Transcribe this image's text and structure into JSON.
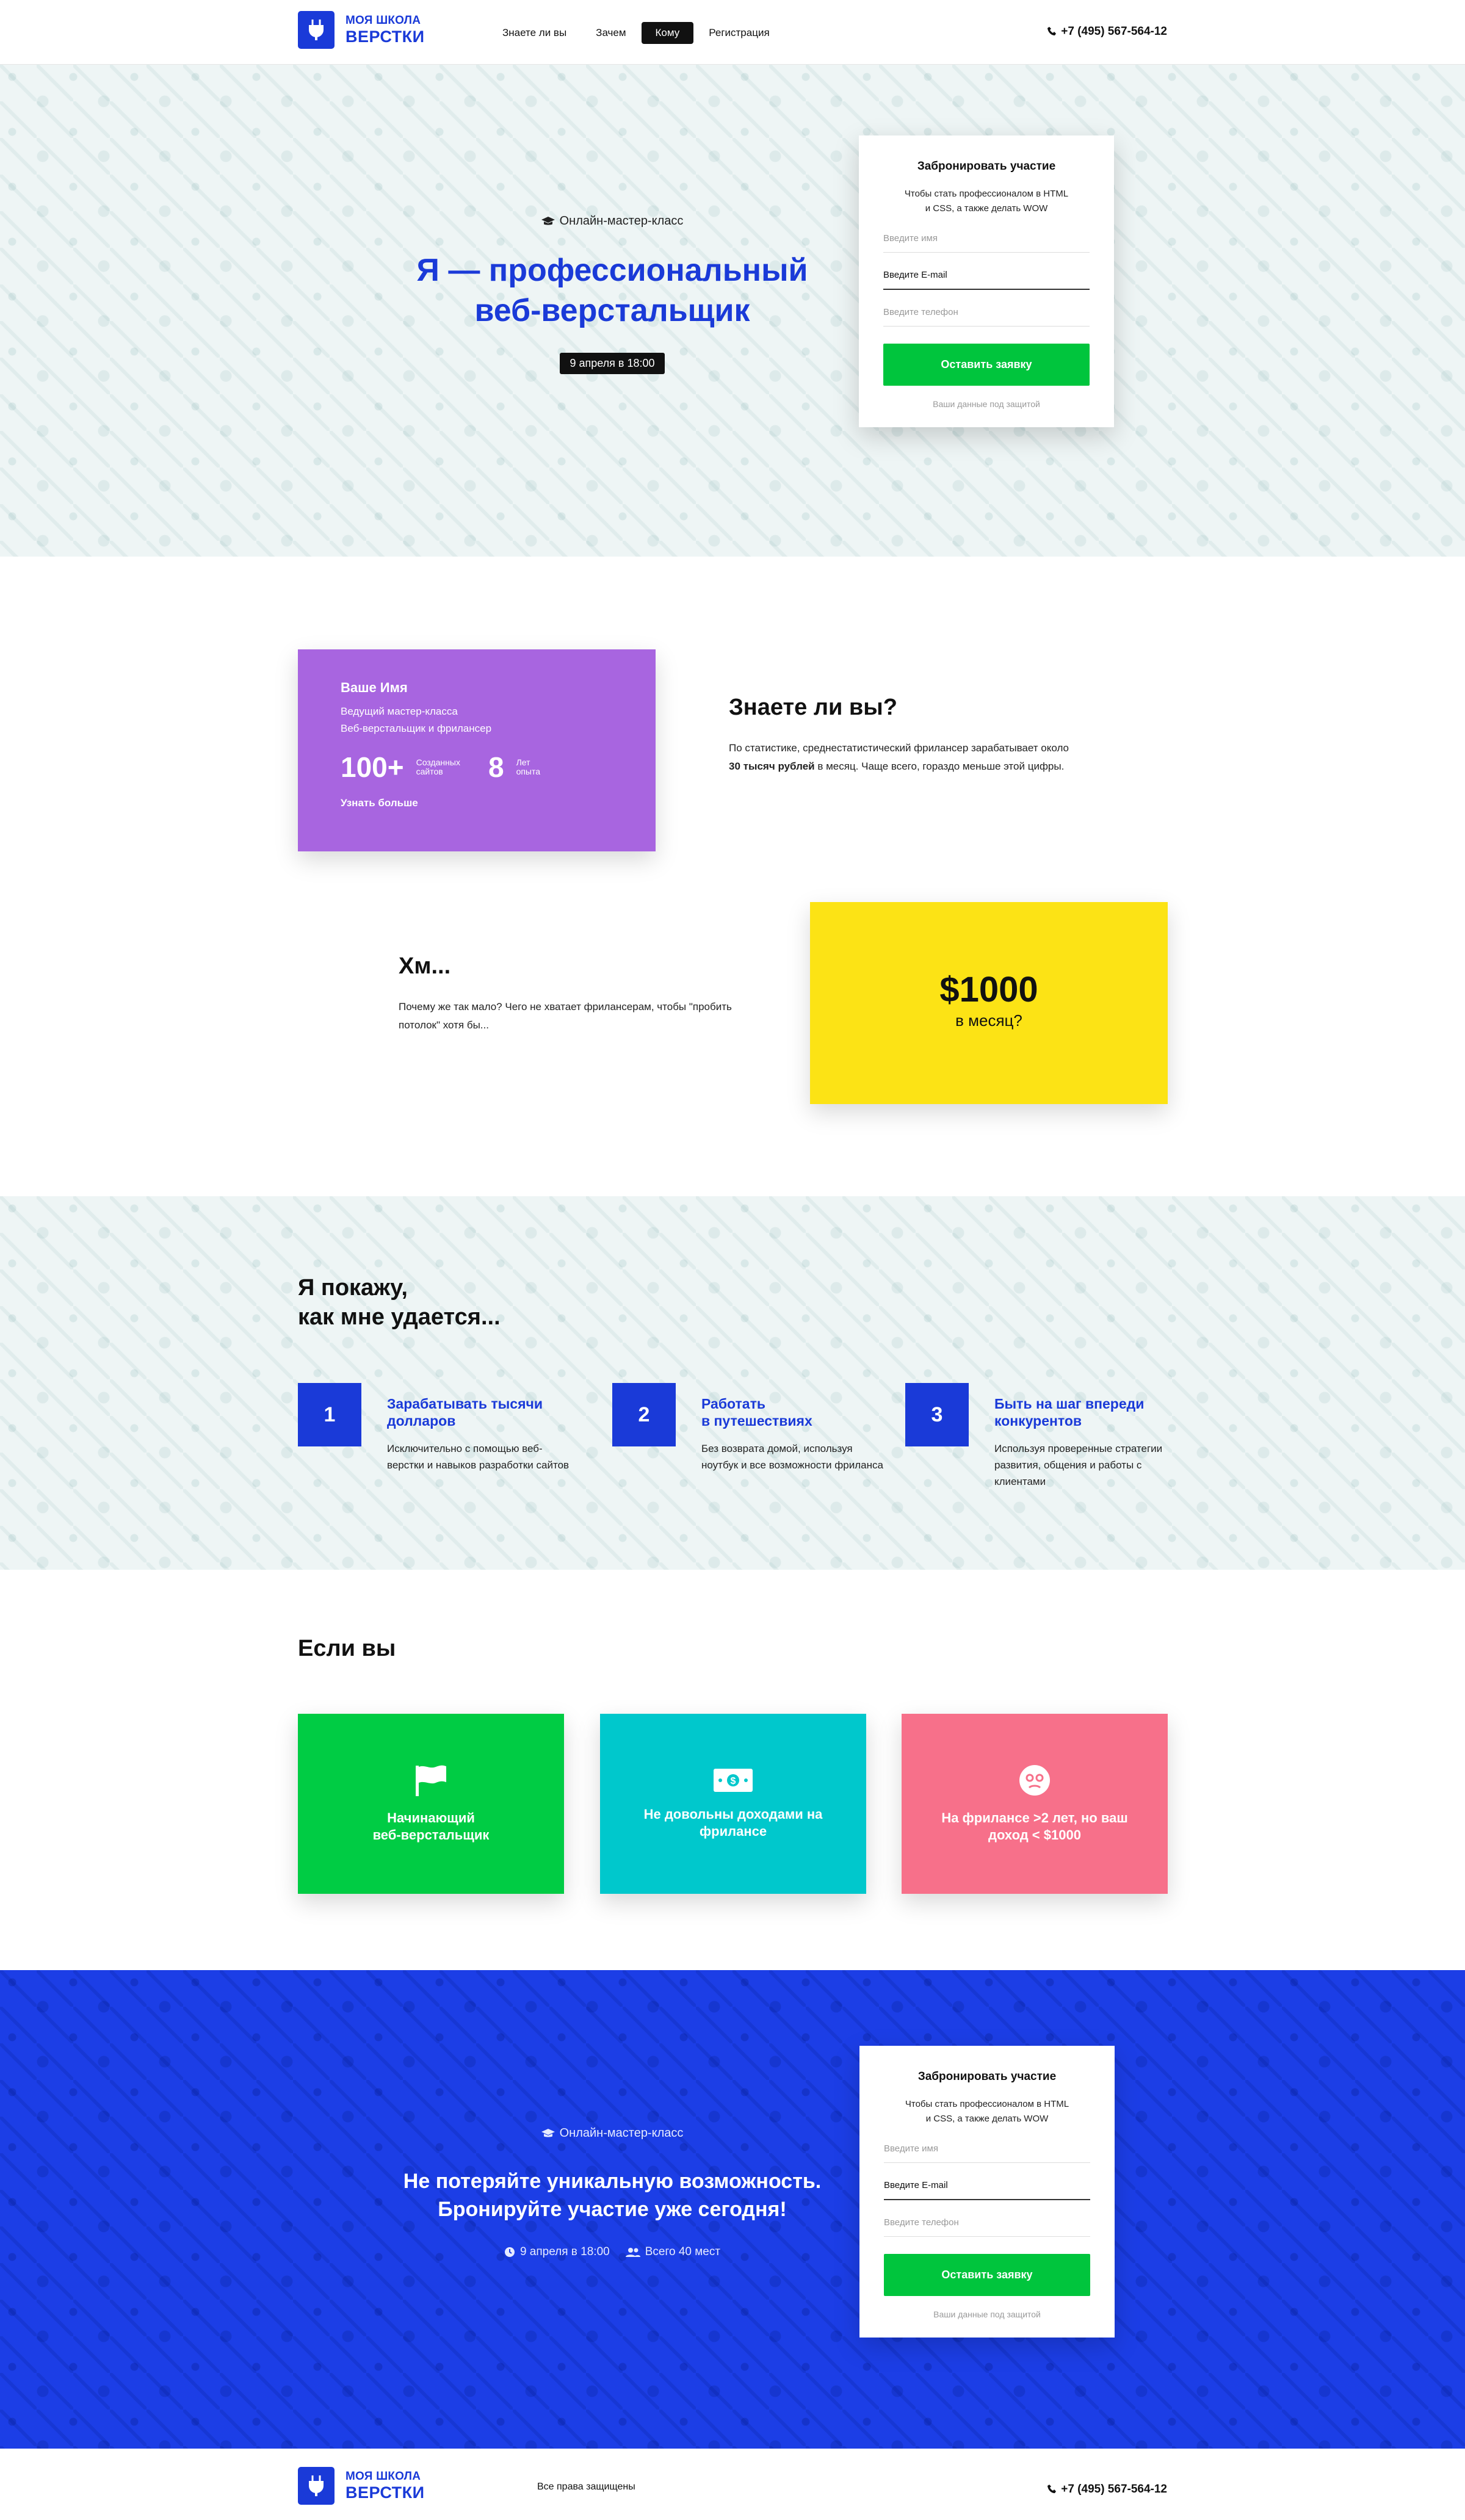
{
  "brand": {
    "line1": "МОЯ ШКОЛА",
    "line2": "ВЕРСТКИ"
  },
  "nav": [
    {
      "label": "Знаете ли вы",
      "active": false
    },
    {
      "label": "Зачем",
      "active": false
    },
    {
      "label": "Кому",
      "active": true
    },
    {
      "label": "Регистрация",
      "active": false
    }
  ],
  "phone": "+7 (495) 567-564-12",
  "hero": {
    "subtitle": "Онлайн-мастер-класс",
    "title_line1": "Я — профессиональный",
    "title_line2": "веб-верстальщик",
    "date": "9 апреля в 18:00"
  },
  "form": {
    "title": "Забронировать участие",
    "desc_line1": "Чтобы стать профессионалом в  HTML",
    "desc_line2": "и CSS, а также делать WOW",
    "name_placeholder": "Введите имя",
    "email_value": "Введите E-mail",
    "phone_placeholder": "Введите телефон",
    "submit": "Оставить заявку",
    "secure": "Ваши данные под защитой"
  },
  "author": {
    "name": "Ваше Имя",
    "role_line1": "Ведущий мастер-класса",
    "role_line2": "Веб-верстальщик и фрилансер",
    "stat1_num": "100+",
    "stat1_label_l1": "Созданных",
    "stat1_label_l2": "сайтов",
    "stat2_num": "8",
    "stat2_label_l1": "Лет",
    "stat2_label_l2": "опыта",
    "more": "Узнать больше"
  },
  "know": {
    "title": "Знаете ли вы?",
    "text_before": "По статистике, среднестатистический фрилансер зарабатывает около ",
    "text_bold": "30 тысяч рублей",
    "text_after": " в месяц. Чаще всего, гораздо меньше этой цифры."
  },
  "hm": {
    "title": "Хм...",
    "text": "Почему же так мало? Чего не хватает фрилансерам, чтобы \"пробить потолок\" хотя бы..."
  },
  "money": {
    "amount": "$1000",
    "period": "в месяц?"
  },
  "steps": {
    "title_line1": "Я покажу,",
    "title_line2": "как мне удается...",
    "items": [
      {
        "num": "1",
        "title_l1": "Зарабатывать тысячи",
        "title_l2": "долларов",
        "desc": "Исключительно с помощью веб-верстки и навыков разработки сайтов"
      },
      {
        "num": "2",
        "title_l1": "Работать",
        "title_l2": "в путешествиях",
        "desc": "Без возврата домой, используя ноутбук и все возможности фриланса"
      },
      {
        "num": "3",
        "title_l1": "Быть на шаг впереди",
        "title_l2": "конкурентов",
        "desc": "Используя проверенные стратегии развития, общения и работы с клиентами"
      }
    ]
  },
  "ifyou": {
    "title": "Если вы",
    "cards": [
      {
        "l1": "Начинающий",
        "l2": "веб-верстальщик",
        "color": "#00cc44",
        "icon": "flag-icon"
      },
      {
        "l1": "Не довольны доходами на",
        "l2": "фрилансе",
        "color": "#00c8cc",
        "icon": "money-icon"
      },
      {
        "l1": "На фрилансе >2 лет, но ваш",
        "l2": "доход < $1000",
        "color": "#f7708a",
        "icon": "sad-face-icon"
      }
    ]
  },
  "cta": {
    "subtitle": "Онлайн-мастер-класс",
    "title_line1": "Не потеряйте уникальную возможность.",
    "title_line2": "Бронируйте участие уже сегодня!",
    "date": "9 апреля в 18:00",
    "seats": "Всего 40 мест"
  },
  "footer": {
    "rights": "Все права защищены"
  },
  "colors": {
    "brand_blue": "#1a3ad8",
    "green": "#00c53d",
    "purple": "#a865e0",
    "yellow": "#fce315"
  }
}
